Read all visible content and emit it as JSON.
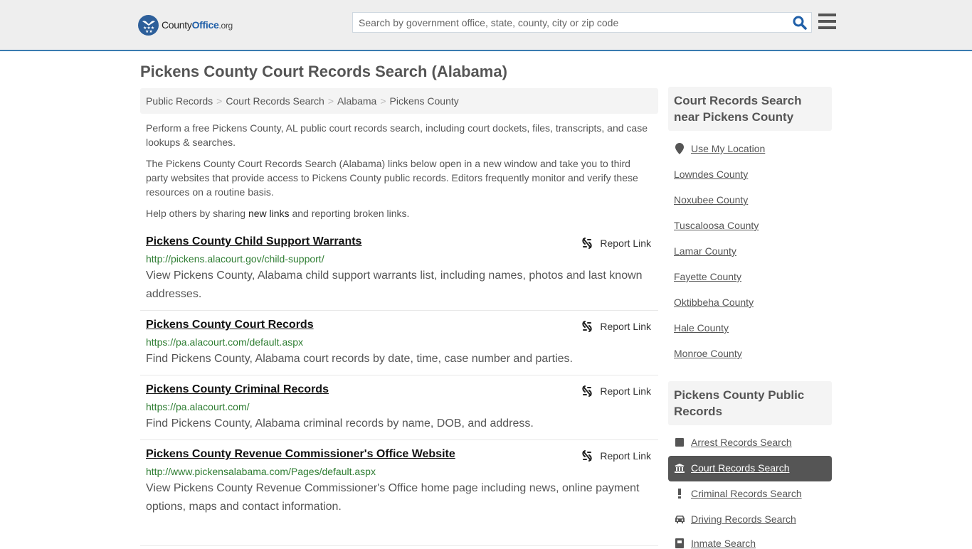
{
  "header": {
    "logo": {
      "county": "County",
      "office": "Office",
      "org": ".org"
    },
    "search_placeholder": "Search by government office, state, county, city or zip code",
    "brand_color": "#2d5f9a",
    "accent_border": "#3a7bb0"
  },
  "page_title": "Pickens County Court Records Search (Alabama)",
  "breadcrumb": [
    "Public Records",
    "Court Records Search",
    "Alabama",
    "Pickens County"
  ],
  "intro": {
    "p1": "Perform a free Pickens County, AL public court records search, including court dockets, files, transcripts, and case lookups & searches.",
    "p2": "The Pickens County Court Records Search (Alabama) links below open in a new window and take you to third party websites that provide access to Pickens County public records. Editors frequently monitor and verify these resources on a routine basis.",
    "p3_before": "Help others by sharing ",
    "p3_link": "new links",
    "p3_after": " and reporting broken links."
  },
  "report_label": "Report Link",
  "results": [
    {
      "title": "Pickens County Child Support Warrants",
      "url": "http://pickens.alacourt.gov/child-support/",
      "desc": "View Pickens County, Alabama child support warrants list, including names, photos and last known addresses."
    },
    {
      "title": "Pickens County Court Records",
      "url": "https://pa.alacourt.com/default.aspx",
      "desc": "Find Pickens County, Alabama court records by date, time, case number and parties."
    },
    {
      "title": "Pickens County Criminal Records",
      "url": "https://pa.alacourt.com/",
      "desc": "Find Pickens County, Alabama criminal records by name, DOB, and address."
    },
    {
      "title": "Pickens County Revenue Commissioner's Office Website",
      "url": "http://www.pickensalabama.com/Pages/default.aspx",
      "desc": "View Pickens County Revenue Commissioner's Office home page including news, online payment options, maps and contact information."
    }
  ],
  "sidebar": {
    "nearby_title": "Court Records Search near Pickens County",
    "use_location": "Use My Location",
    "nearby": [
      "Lowndes County",
      "Noxubee County",
      "Tuscaloosa County",
      "Lamar County",
      "Fayette County",
      "Oktibbeha County",
      "Hale County",
      "Monroe County"
    ],
    "public_title": "Pickens County Public Records",
    "public_links": [
      {
        "label": "Arrest Records Search",
        "icon": "square-icon"
      },
      {
        "label": "Court Records Search",
        "icon": "courthouse-icon",
        "active": true
      },
      {
        "label": "Criminal Records Search",
        "icon": "exclamation-icon"
      },
      {
        "label": "Driving Records Search",
        "icon": "car-icon"
      },
      {
        "label": "Inmate Search",
        "icon": "inmate-icon"
      }
    ]
  }
}
